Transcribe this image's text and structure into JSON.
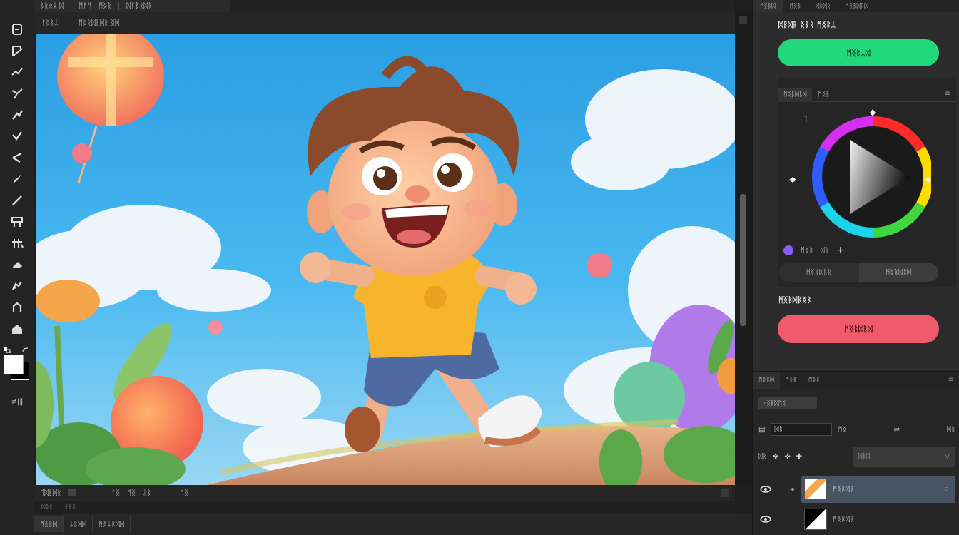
{
  "menubar": {
    "items": [
      "ᛒᚱᛟᛦ ᛞ",
      "ᛗᚠᛗ",
      "ᛗᛝᚱ",
      "ᛞᚠᛒᚱᛞᚱ"
    ]
  },
  "document": {
    "tabs": [
      "ᚠᛝᛒᛦ",
      "ᛗᛝᚱᛞᛒᛞᚱ ᛝᛞ"
    ],
    "status": {
      "zoom": "ᛖᛞᛒᛞᚱ",
      "info": [
        "ᚠᛝ",
        "ᛗᛝ",
        "ᛦᛒ",
        "ᛗᛝ"
      ]
    },
    "bottom_strip": [
      "ᛞᛝᚱ",
      "ᛝᛒᛝ"
    ],
    "bottom_tabs": [
      "ᛗᛝᛒᛞ",
      "ᛦᛒᛞᛞ",
      "ᛗᛝᛦᛒᛞᛞ"
    ]
  },
  "right_panel": {
    "tabs": [
      "ᛗᛝᛒᛞ",
      "ᛗᛝᛒ",
      "ᛞᛒᛞᚱ",
      "ᛗᛝᛒᛞᚱᛞ"
    ],
    "ai_section": {
      "title": "ᛞᛒᛞᚱ ᛝᛒᚱ ᛗᛝᛒᛦ",
      "button_label": "ᛗᛝᛒᛦᛞ"
    },
    "color_panel": {
      "tabs": [
        "ᛗᛝᛒᛞᛒᛞ",
        "ᛗᛝᛒ"
      ],
      "tool_labels": [
        "ᛗᛝᛒ",
        "ᛞᛒ"
      ],
      "toggle": [
        "ᛗᛝᛒᛞᛒᚱ",
        "ᛗᛝᛒᛞᛒᛞ"
      ],
      "accent": "#8a5cf5"
    },
    "generate_section": {
      "title": "ᛗᛝᛒᛞᛒᛝᛒ",
      "button_label": "ᛗᛝᛒᛞᛒᛞ"
    },
    "colors": {
      "generate_green": "#21d97a",
      "generate_red": "#f05b6c"
    }
  },
  "layers": {
    "tabs": [
      "ᛗᛝᛒᛞ",
      "ᛗᛝᛒ",
      "ᛗᛝᛒ"
    ],
    "filter_label": "ᚲᛝᛒᛞᛗᛝ",
    "opacity_value": "ᛞᛒ",
    "row1_labels": [
      "ᛗᛝ",
      "ᛞᛒ"
    ],
    "row2_labels": [
      "ᛞᛒ"
    ],
    "blend_placeholder": "ᛞᛒᛞ",
    "items": [
      {
        "name": "ᛗᛝᛒᛞᛒ",
        "selected": true
      },
      {
        "name": "ᛗᛝᛒᛞᛒ",
        "selected": false
      }
    ]
  }
}
